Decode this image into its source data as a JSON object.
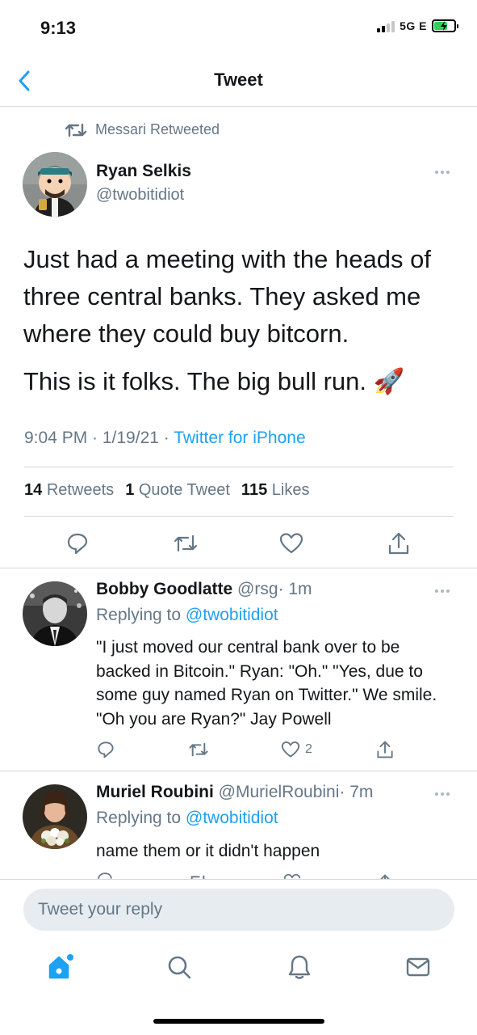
{
  "status_bar": {
    "time": "9:13",
    "network": "5G E"
  },
  "nav": {
    "title": "Tweet"
  },
  "colors": {
    "accent": "#1da1f2",
    "muted": "#657786",
    "divider": "#d6d9dc",
    "battery_charging": "#2fd158"
  },
  "main_tweet": {
    "retweeted_by": "Messari Retweeted",
    "author_name": "Ryan Selkis",
    "author_handle": "@twobitidiot",
    "text_p1": "Just had a meeting with the heads of three central banks. They asked me where they could buy bitcorn.",
    "text_p2": "This is it folks. The big bull run.",
    "emoji": "🚀",
    "timestamp": "9:04 PM · 1/19/21 · ",
    "source": "Twitter for iPhone",
    "retweets_count": "14",
    "retweets_label": "Retweets",
    "quotes_count": "1",
    "quotes_label": "Quote Tweet",
    "likes_count": "115",
    "likes_label": "Likes"
  },
  "replies": [
    {
      "author_name": "Bobby Goodlatte",
      "author_handle": "@rsg",
      "time": "· 1m",
      "replying_prefix": "Replying to ",
      "replying_to": "@twobitidiot",
      "text": "\"I just moved our central bank over to be backed in Bitcoin.\" Ryan: \"Oh.\"  \"Yes, due to some guy named Ryan on Twitter.\"  We smile.  \"Oh you are Ryan?\"  Jay Powell",
      "like_count": "2"
    },
    {
      "author_name": "Muriel Roubini",
      "author_handle": "@MurielRoubini",
      "time": "· 7m",
      "replying_prefix": "Replying to ",
      "replying_to": "@twobitidiot",
      "text": "name them or it didn't happen"
    }
  ],
  "composer": {
    "placeholder": "Tweet your reply"
  },
  "tab_bar": {
    "icons": [
      "home-icon",
      "search-icon",
      "notifications-icon",
      "messages-icon"
    ]
  }
}
